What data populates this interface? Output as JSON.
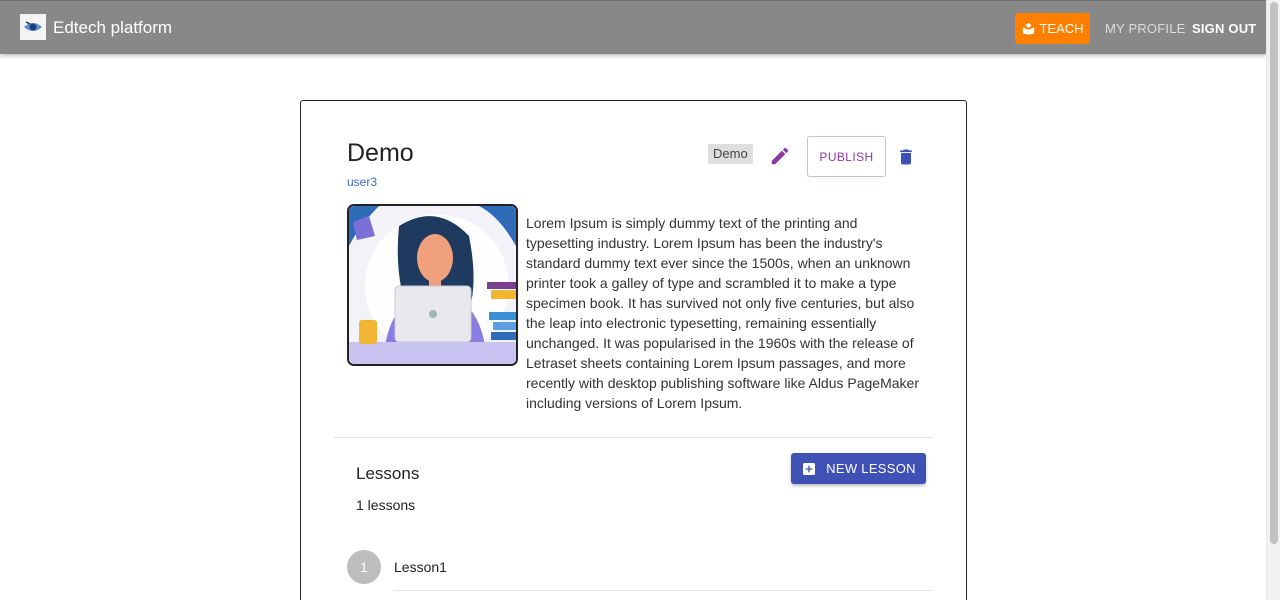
{
  "header": {
    "brand": "Edtech platform",
    "logo_icon": "eye-logo-icon",
    "teach_label": "TEACH",
    "teach_icon": "teach-book-icon",
    "my_profile_label": "MY PROFILE",
    "sign_out_label": "SIGN OUT",
    "colors": {
      "bar": "#888888",
      "teach": "#ff7f00"
    }
  },
  "course": {
    "title": "Demo",
    "author": "user3",
    "category": "Demo",
    "publish_label": "PUBLISH",
    "edit_icon": "pencil-icon",
    "delete_icon": "trash-icon",
    "description": "Lorem Ipsum is simply dummy text of the printing and typesetting industry. Lorem Ipsum has been the industry's standard dummy text ever since the 1500s, when an unknown printer took a galley of type and scrambled it to make a type specimen book. It has survived not only five centuries, but also the leap into electronic typesetting, remaining essentially unchanged. It was popularised in the 1960s with the release of Letraset sheets containing Lorem Ipsum passages, and more recently with desktop publishing software like Aldus PageMaker including versions of Lorem Ipsum.",
    "colors": {
      "accent": "#8e3aa4",
      "delete": "#3f51b5",
      "author_link": "#3f6cc4"
    }
  },
  "lessons": {
    "title": "Lessons",
    "count_text": "1 lessons",
    "new_lesson_label": "NEW LESSON",
    "new_lesson_icon": "add-box-icon",
    "button_color": "#3f51b5",
    "items": [
      {
        "number": "1",
        "name": "Lesson1"
      }
    ]
  }
}
